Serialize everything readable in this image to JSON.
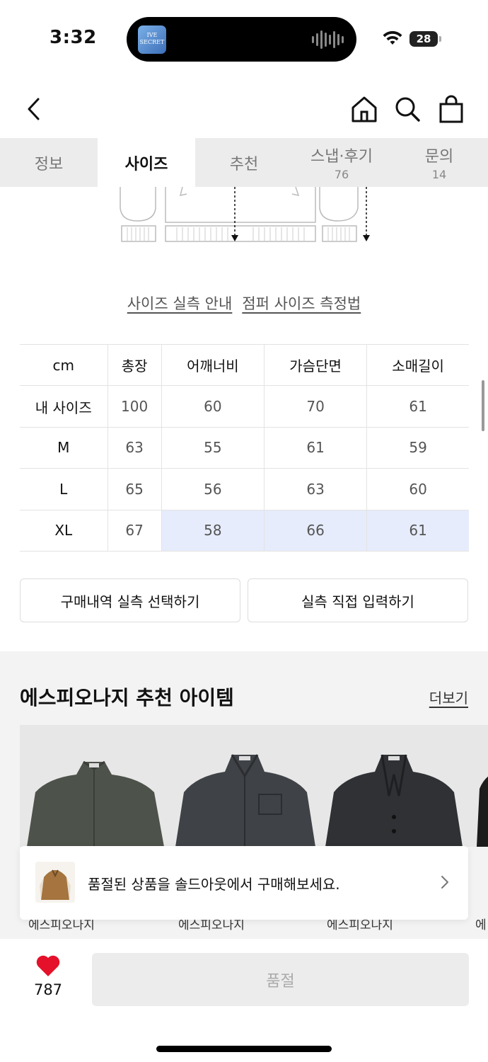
{
  "status": {
    "time": "3:32",
    "battery": "28",
    "island_art": "IVE SECRET"
  },
  "header": {
    "back": "back",
    "home": "home",
    "search": "search",
    "cart": "cart"
  },
  "tabs": [
    {
      "label": "정보",
      "count": ""
    },
    {
      "label": "사이즈",
      "count": ""
    },
    {
      "label": "추천",
      "count": ""
    },
    {
      "label": "스냅·후기",
      "count": "76"
    },
    {
      "label": "문의",
      "count": "14"
    }
  ],
  "size_links": {
    "guide": "사이즈 실측 안내",
    "measure": "점퍼 사이즈 측정법"
  },
  "size_table": {
    "headers": [
      "cm",
      "총장",
      "어깨너비",
      "가슴단면",
      "소매길이"
    ],
    "rows": [
      [
        "내 사이즈",
        "100",
        "60",
        "70",
        "61"
      ],
      [
        "M",
        "63",
        "55",
        "61",
        "59"
      ],
      [
        "L",
        "65",
        "56",
        "63",
        "60"
      ],
      [
        "XL",
        "67",
        "58",
        "66",
        "61"
      ]
    ]
  },
  "actions": {
    "purchase_history": "구매내역 실측 선택하기",
    "direct_input": "실측 직접 입력하기"
  },
  "recommend": {
    "title": "에스피오나지 추천 아이템",
    "more": "더보기",
    "peek_brands": [
      "에스피오나지",
      "에스피오나지",
      "에스피오나지",
      "에"
    ]
  },
  "toast": {
    "text": "품절된 상품을 솔드아웃에서 구매해보세요."
  },
  "bottom": {
    "like_count": "787",
    "soldout_label": "품절"
  },
  "colors": {
    "highlight": "#e6ecfb",
    "heart": "#e5112a"
  }
}
